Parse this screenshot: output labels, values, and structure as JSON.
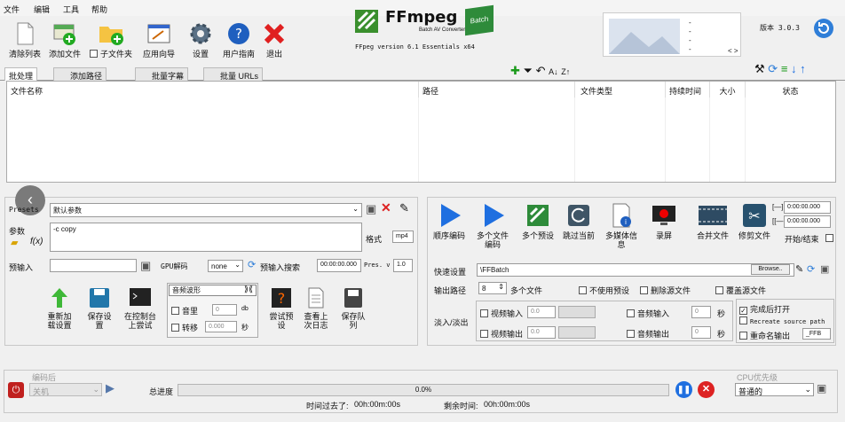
{
  "menu": [
    "文件",
    "编辑",
    "工具",
    "帮助"
  ],
  "toolbar": {
    "clear": "清除列表",
    "add": "添加文件",
    "subfolder": "子文件夹",
    "wizard": "应用向导",
    "settings": "设置",
    "guide": "用户指南",
    "exit": "退出"
  },
  "logo": {
    "brand": "FFmpeg",
    "sub": "Batch AV Converter",
    "badge": "Batch",
    "version": "FFpeg version 6.1 Essentials  x64"
  },
  "preview": {
    "dashes": [
      "-",
      "-",
      "-",
      "-"
    ],
    "nav": "< >"
  },
  "version_label": "版本 3.0.3",
  "tabs": [
    "批处理",
    "添加路径",
    "批量字幕",
    "批量 URLs"
  ],
  "table": {
    "columns": [
      "文件名称",
      "路径",
      "文件类型",
      "持续时间",
      "大小",
      "状态"
    ]
  },
  "left": {
    "presets_label": "Presets",
    "preset_value": "默认参数",
    "params_label": "参数",
    "params_value": "-c copy",
    "format_label": "格式",
    "format_value": "mp4",
    "preinput_label": "预输入",
    "gpu_label": "GPU解码",
    "gpu_value": "none",
    "preinput_search": "预输入搜索",
    "time_value": "00:00:00.000",
    "pres_label": "Pres. v",
    "pres_value": "1.0",
    "buttons": {
      "reload": "重新加载设置",
      "save": "保存设置",
      "console": "在控制台上尝试",
      "try": "尝试预设",
      "view": "查看上次日志",
      "save_queue": "保存队列"
    },
    "audio": {
      "wave": "音频波形",
      "mono": "音里",
      "mono_val": "0",
      "db": "db",
      "shift": "转移",
      "shift_val": "0.000",
      "sec": "秒"
    }
  },
  "right": {
    "buttons": {
      "seq": "顺序编码",
      "multi": "多个文件编码",
      "multi_preset": "多个预设",
      "skip": "跳过当前",
      "media_info": "多媒体信息",
      "record": "录屏",
      "merge": "合并文件",
      "cut": "修剪文件"
    },
    "start_label": "[—]",
    "end_label": "[[—",
    "start_time": "0:00:00.000",
    "end_time": "0:00:00.000",
    "start_end": "开始/结束",
    "quick_label": "快速设置",
    "quick_value": "\\FFBatch",
    "browse": "Browse..",
    "out_label": "输出路径",
    "out_num": "8",
    "multi_files": "多个文件",
    "no_preset": "不使用预设",
    "del_source": "删除源文件",
    "overwrite": "覆盖源文件",
    "fade_label": "淡入/淡出",
    "video_in": "视频输入",
    "video_out": "视频输出",
    "fade_val1": "0.0",
    "fade_val2": "0.0",
    "audio_in": "音频输入",
    "audio_out": "音频输出",
    "a_val1": "0",
    "a_val2": "0",
    "sec": "秒",
    "open_done": "完成后打开",
    "recreate": "Recreate source path",
    "rename": "重命名输出",
    "rename_value": "_FFB"
  },
  "footer": {
    "after_label": "编码后",
    "after_value": "关机",
    "total": "总进度",
    "percent": "0.0%",
    "elapsed_label": "时间过去了:",
    "elapsed": "00h:00m:00s",
    "remain_label": "剩余时间:",
    "remain": "00h:00m:00s",
    "cpu_label": "CPU优先级",
    "cpu_value": "普通的"
  }
}
